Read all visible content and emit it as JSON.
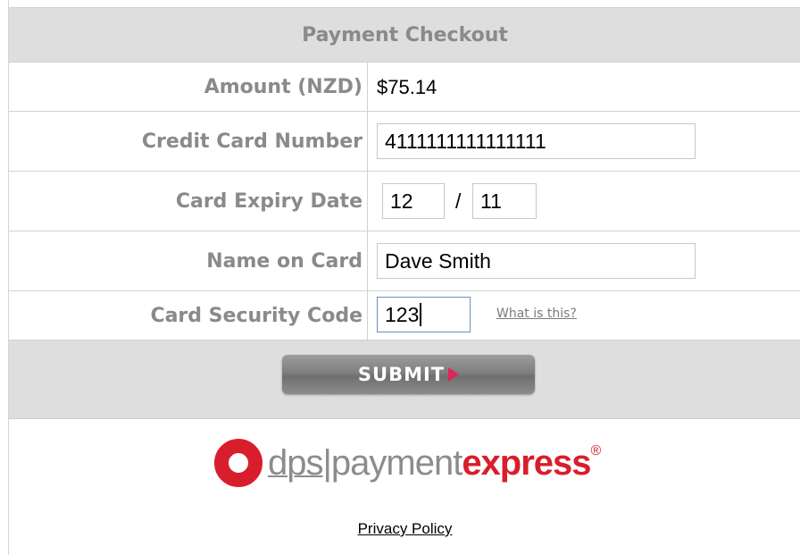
{
  "header": {
    "title": "Payment Checkout"
  },
  "form": {
    "amount_label": "Amount (NZD)",
    "amount_value": "$75.14",
    "card_number_label": "Credit Card Number",
    "card_number_value": "4111111111111111",
    "expiry_label": "Card Expiry Date",
    "expiry_month": "12",
    "expiry_separator": "/",
    "expiry_year": "11",
    "name_label": "Name on Card",
    "name_value": "Dave Smith",
    "cvc_label": "Card Security Code",
    "cvc_value": "123",
    "cvc_help_link": "What is this?"
  },
  "actions": {
    "submit_label": "SUBMIT",
    "submit_icon": "play-arrow-icon"
  },
  "logo": {
    "part1": "dps",
    "separator": "|",
    "part2": "payment",
    "part3": "express",
    "mark": "®",
    "ring_color": "#d81e2c"
  },
  "footer": {
    "privacy_link": "Privacy Policy"
  }
}
